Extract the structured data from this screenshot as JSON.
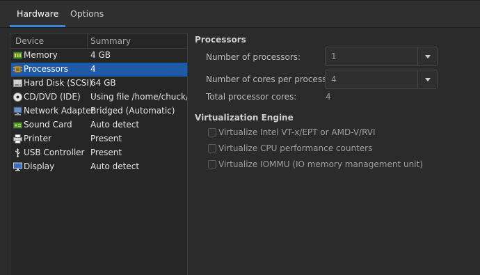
{
  "tabs": [
    {
      "label": "Hardware",
      "active": true
    },
    {
      "label": "Options",
      "active": false
    }
  ],
  "device_list": {
    "columns": [
      "Device",
      "Summary"
    ],
    "selected_index": 1,
    "rows": [
      {
        "device": "Memory",
        "summary": "4 GB",
        "icon": "memory-icon"
      },
      {
        "device": "Processors",
        "summary": "4",
        "icon": "processor-icon"
      },
      {
        "device": "Hard Disk (SCSI)",
        "summary": "64 GB",
        "icon": "hard-disk-icon"
      },
      {
        "device": "CD/DVD (IDE)",
        "summary": "Using file /home/chuck/Dov",
        "icon": "cd-dvd-icon"
      },
      {
        "device": "Network Adapter",
        "summary": "Bridged (Automatic)",
        "icon": "network-adapter-icon"
      },
      {
        "device": "Sound Card",
        "summary": "Auto detect",
        "icon": "sound-card-icon"
      },
      {
        "device": "Printer",
        "summary": "Present",
        "icon": "printer-icon"
      },
      {
        "device": "USB Controller",
        "summary": "Present",
        "icon": "usb-icon"
      },
      {
        "device": "Display",
        "summary": "Auto detect",
        "icon": "display-icon"
      }
    ]
  },
  "processors": {
    "section_title": "Processors",
    "num_processors_label": "Number of processors:",
    "num_processors_value": "1",
    "cores_label": "Number of cores per processor:",
    "cores_value": "4",
    "total_label": "Total processor cores:",
    "total_value": "4"
  },
  "virtualization": {
    "section_title": "Virtualization Engine",
    "options": [
      {
        "label": "Virtualize Intel VT-x/EPT or AMD-V/RVI",
        "checked": false
      },
      {
        "label": "Virtualize CPU performance counters",
        "checked": false
      },
      {
        "label": "Virtualize IOMMU (IO memory management unit)",
        "checked": false
      }
    ]
  }
}
